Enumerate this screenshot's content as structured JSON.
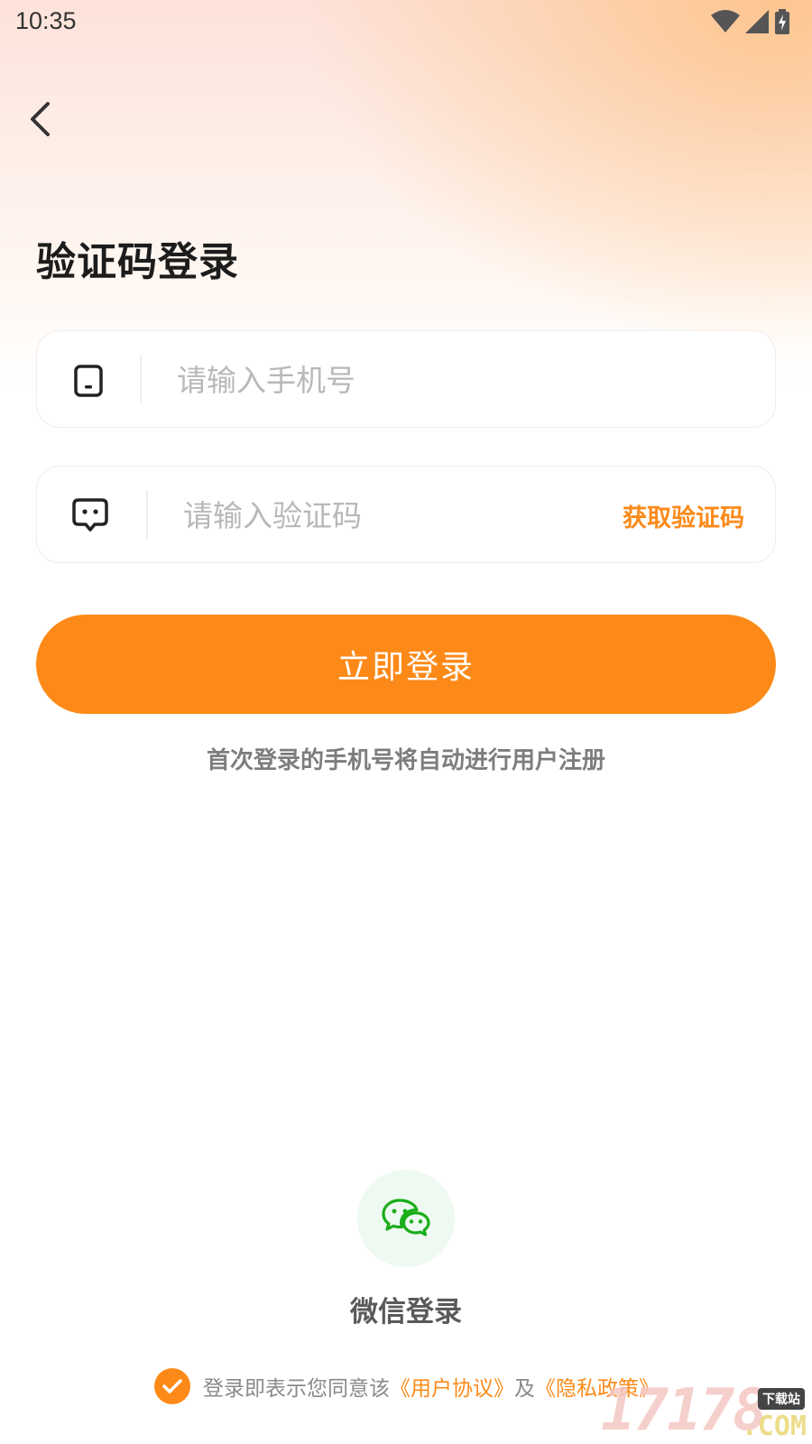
{
  "status_bar": {
    "time": "10:35",
    "icons": [
      "wifi-icon",
      "signal-icon",
      "battery-icon"
    ]
  },
  "header": {
    "back_icon": "chevron-left-icon",
    "title": "验证码登录"
  },
  "form": {
    "phone": {
      "icon": "phone-icon",
      "placeholder": "请输入手机号",
      "value": ""
    },
    "code": {
      "icon": "message-icon",
      "placeholder": "请输入验证码",
      "value": "",
      "get_code_label": "获取验证码"
    },
    "submit_label": "立即登录",
    "register_note": "首次登录的手机号将自动进行用户注册"
  },
  "wechat": {
    "icon": "wechat-icon",
    "label": "微信登录"
  },
  "agreement": {
    "checked": true,
    "prefix": "登录即表示您同意该",
    "user_agreement": "《用户协议》",
    "conjunction": "及",
    "privacy_policy": "《隐私政策》"
  },
  "watermark": {
    "number": "17178",
    "suffix": ".COM",
    "tag": "下载站"
  },
  "colors": {
    "accent": "#fd8a18",
    "wechat_green": "#1aad19",
    "title": "#1c1c1c",
    "placeholder": "#b8b8b8"
  }
}
